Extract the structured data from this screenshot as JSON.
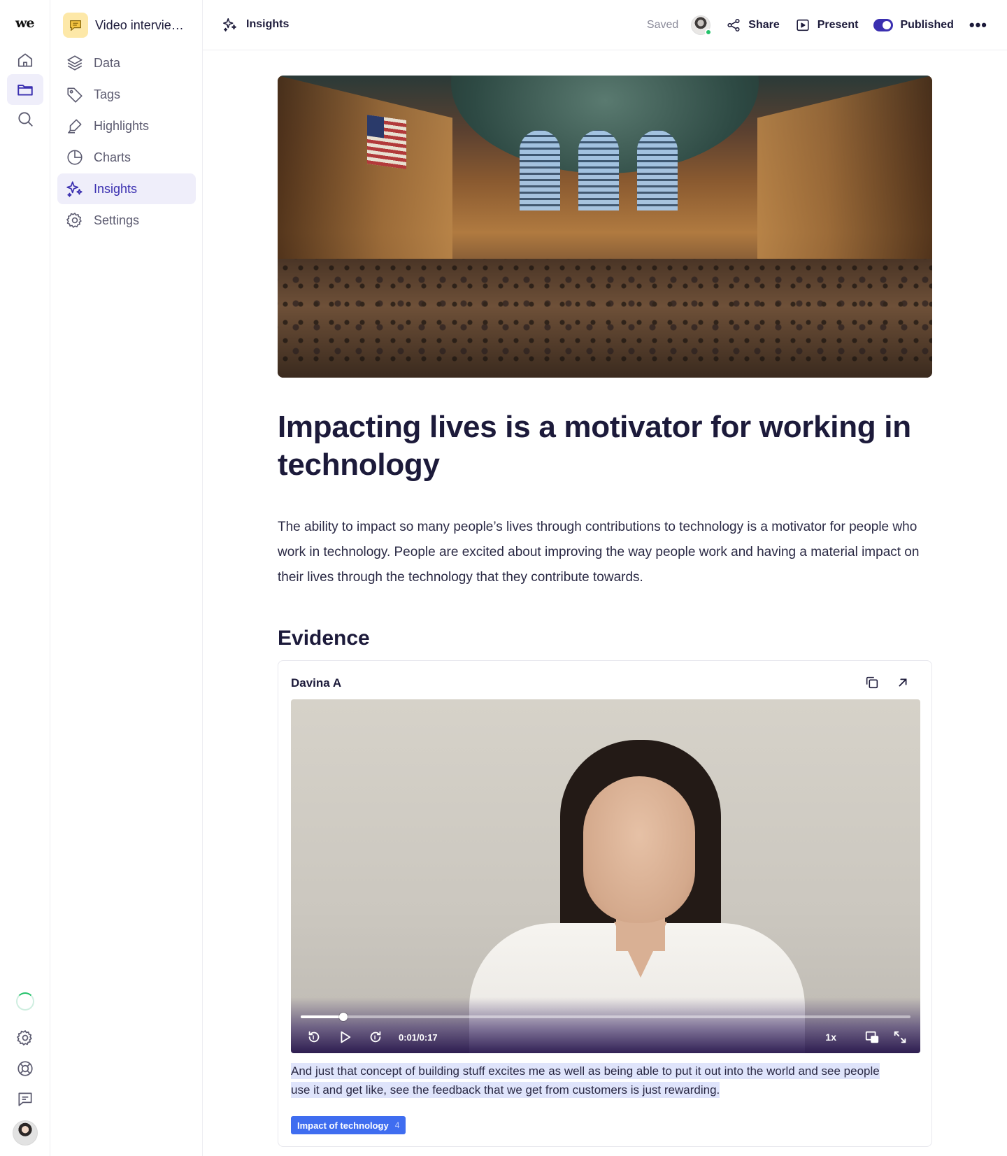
{
  "app": {
    "logo_text": "we",
    "project_name": "Video intervie…"
  },
  "sidebar": {
    "items": [
      {
        "label": "Data",
        "icon": "layers-icon"
      },
      {
        "label": "Tags",
        "icon": "tag-icon"
      },
      {
        "label": "Highlights",
        "icon": "highlighter-icon"
      },
      {
        "label": "Charts",
        "icon": "pie-chart-icon"
      },
      {
        "label": "Insights",
        "icon": "sparkles-icon",
        "active": true
      },
      {
        "label": "Settings",
        "icon": "gear-icon"
      }
    ]
  },
  "header": {
    "breadcrumb": "Insights",
    "saved_status": "Saved",
    "share_label": "Share",
    "present_label": "Present",
    "published_label": "Published",
    "published_on": true
  },
  "insight": {
    "title": "Impacting lives is a motivator for working in technology",
    "description": "The ability to impact so many people’s lives through contributions to technology is a motivator for people who work in technology. People are excited about improving the way people work and having a material impact on their lives through the technology that they contribute towards.",
    "evidence_heading": "Evidence"
  },
  "evidence": {
    "participant": "Davina A",
    "video": {
      "time": "0:01/0:17",
      "progress_fraction": 0.07,
      "speed": "1x"
    },
    "quote": "And just that concept of building stuff excites me as well as being able to put it out into the world and see people use it and get like, see the feedback that we get from customers is just rewarding.",
    "tag": {
      "label": "Impact of technology",
      "count": "4"
    }
  },
  "colors": {
    "accent": "#3a2fb0",
    "tag_blue": "#3f6df0",
    "highlight": "#dfe4fb",
    "online": "#23c26a"
  }
}
